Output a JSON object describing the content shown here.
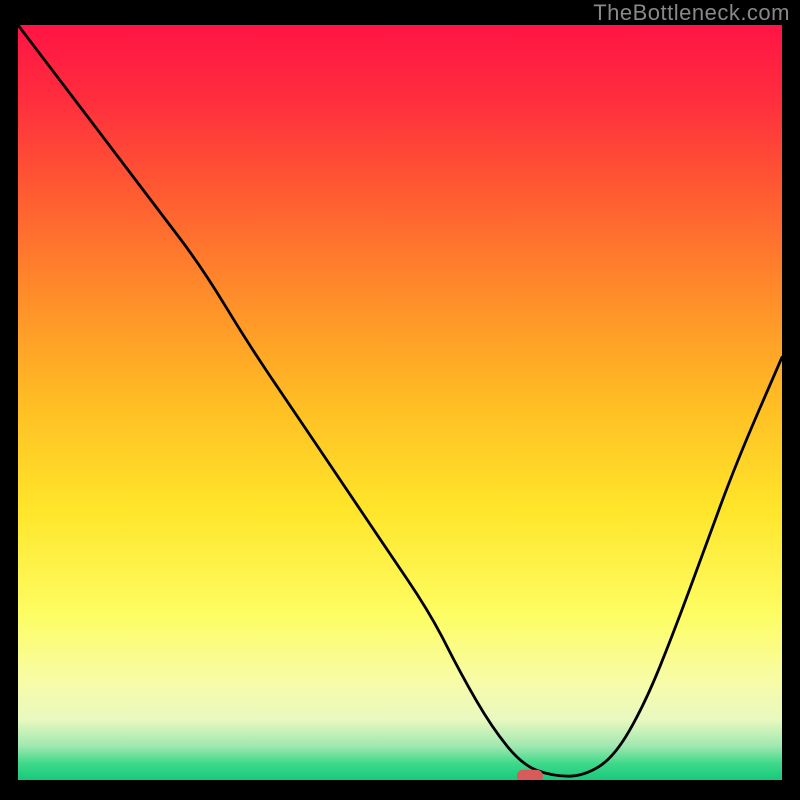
{
  "attribution": "TheBottleneck.com",
  "gradient_stops": [
    {
      "offset": 0.0,
      "color": "#ff1444"
    },
    {
      "offset": 0.1,
      "color": "#ff2e3e"
    },
    {
      "offset": 0.22,
      "color": "#ff5a32"
    },
    {
      "offset": 0.35,
      "color": "#ff8a2a"
    },
    {
      "offset": 0.5,
      "color": "#ffbd24"
    },
    {
      "offset": 0.64,
      "color": "#ffe52a"
    },
    {
      "offset": 0.78,
      "color": "#fdfd62"
    },
    {
      "offset": 0.87,
      "color": "#f8fca8"
    },
    {
      "offset": 0.92,
      "color": "#e8f8c0"
    },
    {
      "offset": 0.955,
      "color": "#a0e8b0"
    },
    {
      "offset": 0.978,
      "color": "#3fd98a"
    },
    {
      "offset": 1.0,
      "color": "#18c97c"
    }
  ],
  "chart_data": {
    "type": "line",
    "title": "",
    "xlabel": "",
    "ylabel": "",
    "xlim": [
      0,
      100
    ],
    "ylim": [
      0,
      100
    ],
    "x": [
      0,
      6,
      12,
      18,
      24,
      30,
      36,
      42,
      48,
      54,
      58,
      62,
      66,
      70,
      74,
      78,
      82,
      86,
      90,
      94,
      100
    ],
    "values": [
      100,
      92,
      84,
      76,
      68,
      58,
      49,
      40,
      31,
      22,
      14,
      7,
      2,
      0.5,
      0.5,
      3,
      10,
      20,
      31,
      42,
      56
    ],
    "marker": {
      "x": 67,
      "y": 0.5
    }
  }
}
